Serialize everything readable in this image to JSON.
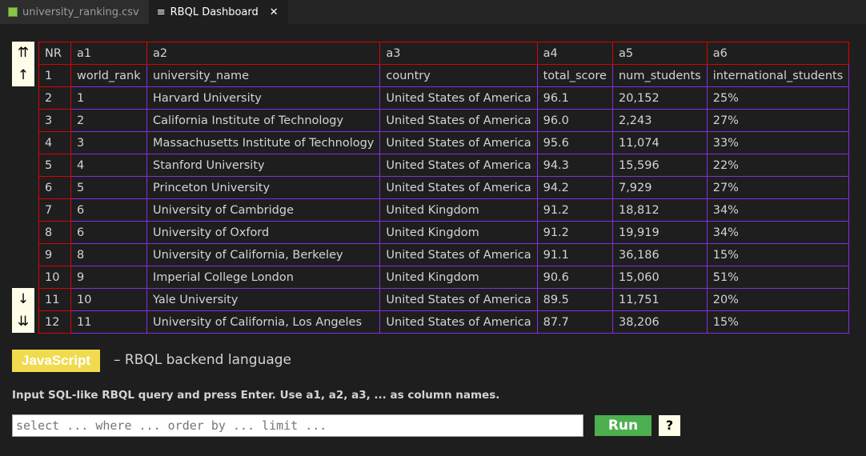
{
  "tabs": [
    {
      "label": "university_ranking.csv"
    },
    {
      "label": "RBQL Dashboard",
      "close": "✕"
    }
  ],
  "nav": {
    "first": "⇈",
    "prev": "↑",
    "next": "↓",
    "last": "⇊"
  },
  "table": {
    "headers": [
      "NR",
      "a1",
      "a2",
      "a3",
      "a4",
      "a5",
      "a6"
    ],
    "rows": [
      [
        "1",
        "world_rank",
        "university_name",
        "country",
        "total_score",
        "num_students",
        "international_students"
      ],
      [
        "2",
        "1",
        "Harvard University",
        "United States of America",
        "96.1",
        "20,152",
        "25%"
      ],
      [
        "3",
        "2",
        "California Institute of Technology",
        "United States of America",
        "96.0",
        "2,243",
        "27%"
      ],
      [
        "4",
        "3",
        "Massachusetts Institute of Technology",
        "United States of America",
        "95.6",
        "11,074",
        "33%"
      ],
      [
        "5",
        "4",
        "Stanford University",
        "United States of America",
        "94.3",
        "15,596",
        "22%"
      ],
      [
        "6",
        "5",
        "Princeton University",
        "United States of America",
        "94.2",
        "7,929",
        "27%"
      ],
      [
        "7",
        "6",
        "University of Cambridge",
        "United Kingdom",
        "91.2",
        "18,812",
        "34%"
      ],
      [
        "8",
        "6",
        "University of Oxford",
        "United Kingdom",
        "91.2",
        "19,919",
        "34%"
      ],
      [
        "9",
        "8",
        "University of California, Berkeley",
        "United States of America",
        "91.1",
        "36,186",
        "15%"
      ],
      [
        "10",
        "9",
        "Imperial College London",
        "United Kingdom",
        "90.6",
        "15,060",
        "51%"
      ],
      [
        "11",
        "10",
        "Yale University",
        "United States of America",
        "89.5",
        "11,751",
        "20%"
      ],
      [
        "12",
        "11",
        "University of California, Los Angeles",
        "United States of America",
        "87.7",
        "38,206",
        "15%"
      ]
    ]
  },
  "backend": {
    "language": "JavaScript",
    "description": "– RBQL backend language"
  },
  "hint": "Input SQL-like RBQL query and press Enter. Use a1, a2, a3, ... as column names.",
  "query": {
    "value": "",
    "placeholder": "select ... where ... order by ... limit ..."
  },
  "run_label": "Run",
  "help_label": "?"
}
